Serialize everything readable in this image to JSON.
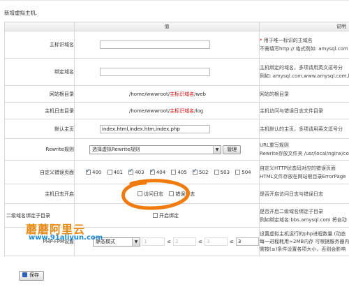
{
  "page_title": "新增虚拟主机.",
  "header": {
    "col_value": "值",
    "col_desc": "说明"
  },
  "rows": {
    "main_domain": {
      "label": "主标识域名",
      "input_value": "",
      "desc_line1_mark": "*",
      "desc_line1": "用于唯一标识的主域名",
      "desc_line2": "不需填写http:// 格式例如: amysql.com"
    },
    "bind_domain": {
      "label": "绑定域名",
      "input_value": "",
      "desc_line1": "主机绑定的域名，多项请用英文逗号分",
      "desc_line2": "例如: amysql.com,www.amysql.com,bb"
    },
    "web_root": {
      "label": "网站根目录",
      "prefix": "/home/wwwroot/",
      "highlight": "主标识域名",
      "suffix": "/web",
      "desc": "网站的根目录"
    },
    "log_dir": {
      "label": "主机日志目录",
      "prefix": "/home/wwwroot/",
      "highlight": "主标识域名",
      "suffix": "/log",
      "desc": "主机访问与错误日志文件目录"
    },
    "default_page": {
      "label": "默认主页",
      "input_value": "index.html,index.htm,index.php",
      "desc": "主机默认的主页，多项请用英文逗号分"
    },
    "rewrite": {
      "label": "Rewrite规则",
      "select_value": "选择虚拟Rewrite规则",
      "button": "管理",
      "desc_line1": "URL重写规则",
      "desc_line2": "Rewrite存放文件夹 /usr/local/nginx/co"
    },
    "error_pages": {
      "label": "自定义错误页面",
      "codes": [
        {
          "code": "400",
          "checked": true
        },
        {
          "code": "401",
          "checked": false
        },
        {
          "code": "403",
          "checked": true
        },
        {
          "code": "404",
          "checked": true
        },
        {
          "code": "405",
          "checked": false
        },
        {
          "code": "502",
          "checked": true
        },
        {
          "code": "503",
          "checked": false
        },
        {
          "code": "504",
          "checked": false
        }
      ],
      "desc_line1": "自定义HTTP状态码对应的错误页面",
      "desc_line2": "HTML文件存放在网站根目录ErrorPage"
    },
    "logging": {
      "label": "主机日志开启",
      "access_log": "访问日志",
      "error_log": "错误日志",
      "desc": "是否开启访问日志与错误日志"
    },
    "sub_domain": {
      "label": "二级域名绑定子目录",
      "checkbox_label": "开启绑定",
      "desc_line1": "是否开启二级域名绑定子目录",
      "desc_line2": "例如绑定域名:bbs.amysql.com 将自动"
    },
    "php_fpm": {
      "label": "PHP-FPM设置",
      "mode": "静态模式",
      "n1": "1",
      "n2": "2",
      "n3": "3",
      "n4": "3",
      "desc_line1": "设置虚拟主机运行的php进程数量 (动态",
      "desc_line2": "每一进程耗用≈2MB内存 可根据服务器内",
      "desc_line3": "需按(≤)条件设置各项大小，否则会影响"
    }
  },
  "save_button": "保存",
  "watermark": {
    "line1": "蘑蘑阿里云",
    "line2": "www.91aliyun.com"
  },
  "colors": {
    "highlight_red": "#dd0000",
    "annotation_orange": "#f07c10"
  }
}
